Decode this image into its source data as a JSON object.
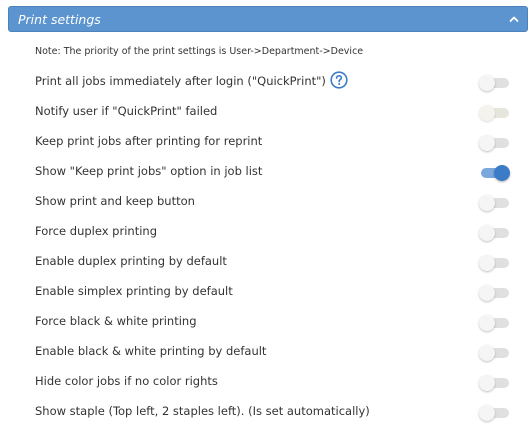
{
  "panel": {
    "title": "Print settings",
    "note": "Note: The priority of the print settings is User->Department->Device"
  },
  "colors": {
    "header_bg": "#5b94cf",
    "toggle_on_knob": "#3c7cc7",
    "toggle_on_track": "#7aa7dc",
    "toggle_off_track": "#e0e0e0"
  },
  "icons": {
    "collapse": "chevron-up-icon",
    "help": "help-circle-icon"
  },
  "settings": [
    {
      "label": "Print all jobs immediately after login (\"QuickPrint\")",
      "enabled": false,
      "has_help": true
    },
    {
      "label": "Notify user if \"QuickPrint\" failed",
      "enabled": false,
      "disabled": true
    },
    {
      "label": "Keep print jobs after printing for reprint",
      "enabled": false
    },
    {
      "label": "Show \"Keep print jobs\" option in job list",
      "enabled": true
    },
    {
      "label": "Show print and keep button",
      "enabled": false
    },
    {
      "label": "Force duplex printing",
      "enabled": false
    },
    {
      "label": "Enable duplex printing by default",
      "enabled": false
    },
    {
      "label": "Enable simplex printing by default",
      "enabled": false
    },
    {
      "label": "Force black & white printing",
      "enabled": false
    },
    {
      "label": "Enable black & white printing by default",
      "enabled": false
    },
    {
      "label": "Hide color jobs if no color rights",
      "enabled": false
    },
    {
      "label": "Show staple (Top left, 2 staples left). (Is set automatically)",
      "enabled": false
    }
  ]
}
